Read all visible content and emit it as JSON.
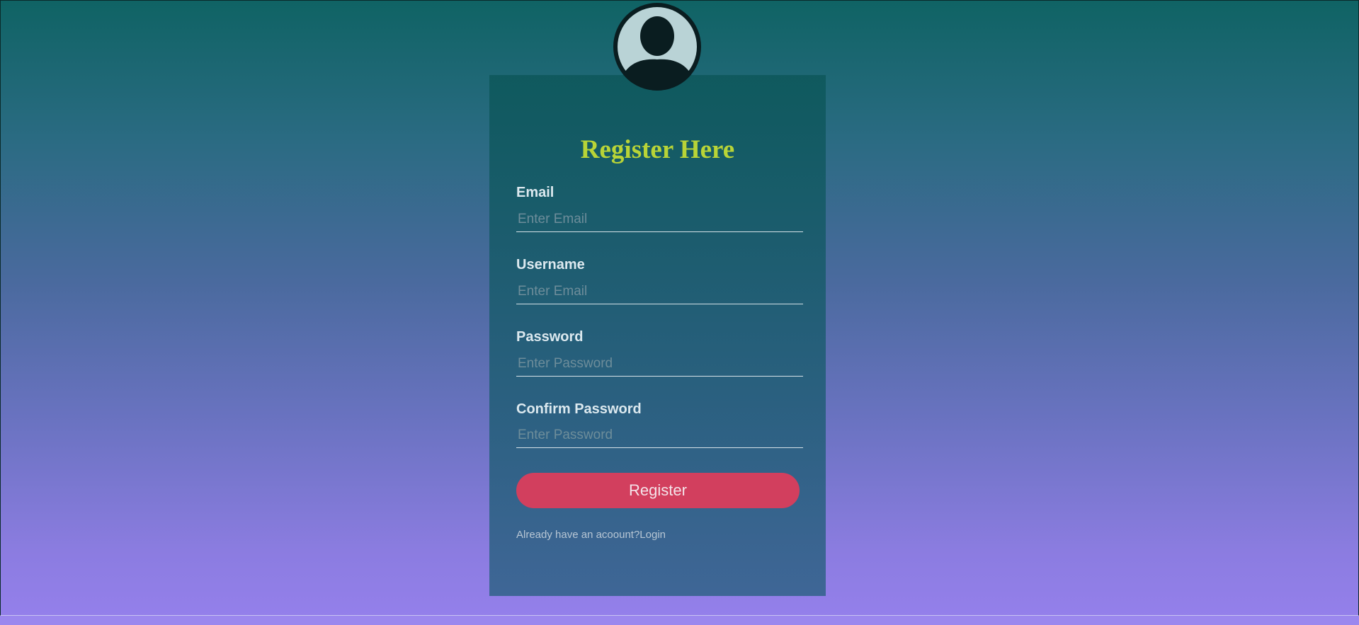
{
  "form": {
    "title": "Register Here",
    "fields": [
      {
        "label": "Email",
        "placeholder": "Enter Email",
        "type": "text"
      },
      {
        "label": "Username",
        "placeholder": "Enter Email",
        "type": "text"
      },
      {
        "label": "Password",
        "placeholder": "Enter Password",
        "type": "password"
      },
      {
        "label": "Confirm Password",
        "placeholder": "Enter Password",
        "type": "password"
      }
    ],
    "submit_label": "Register",
    "login_prompt": "Already have an acoount?",
    "login_link": "Login"
  },
  "colors": {
    "title": "#b8d437",
    "button": "#d23f5e",
    "label": "#dce9ef"
  },
  "icons": {
    "avatar": "user-silhouette-icon"
  }
}
